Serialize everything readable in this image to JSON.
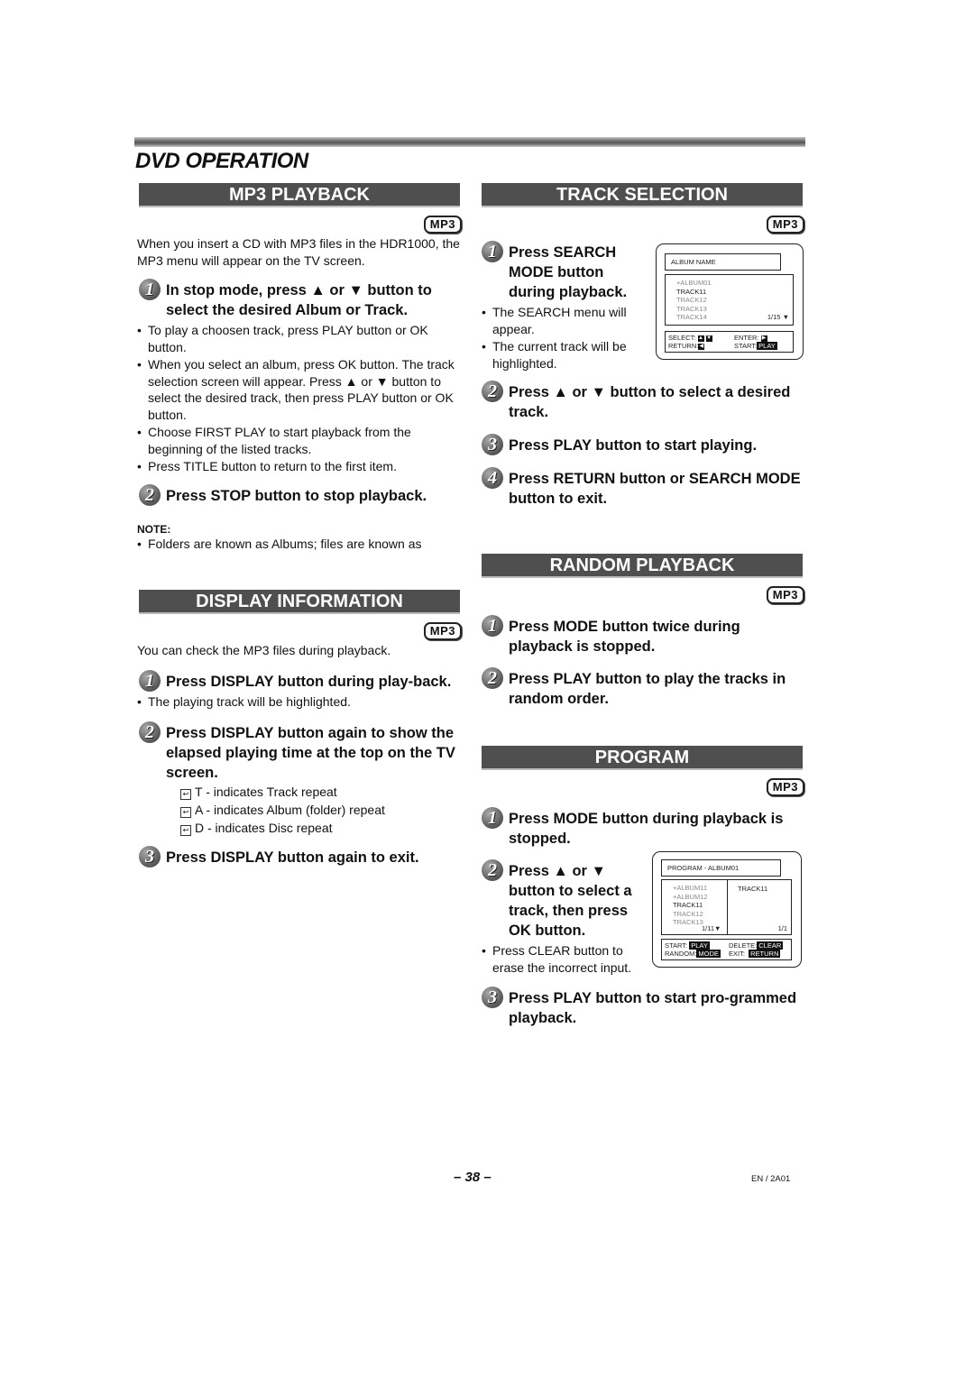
{
  "page": {
    "title": "DVD OPERATION",
    "page_number": "– 38 –",
    "doc_code": "EN / 2A01"
  },
  "badge": "MP3",
  "arrows": {
    "up": "▲",
    "down": "▼"
  },
  "mp3_playback": {
    "heading": "MP3 PLAYBACK",
    "intro": "When you insert a CD with MP3 files in the HDR1000, the MP3 menu will appear on the TV screen.",
    "step1": {
      "num": "1",
      "pre": "In stop mode, press ",
      "mid": " or ",
      "post": " button to select the desired Album or Track."
    },
    "bullets": [
      "To play a choosen track, press PLAY button or OK button.",
      "When you select an album, press OK button. The track selection screen will appear. Press ▲ or ▼ button to select the desired track, then press PLAY button or OK button.",
      "Choose FIRST PLAY to start playback from the beginning of the listed tracks.",
      "Press TITLE button to return to the first item."
    ],
    "step2": {
      "num": "2",
      "text": "Press STOP button to stop playback."
    },
    "note_label": "NOTE:",
    "note": "Folders are known as Albums; files are known as"
  },
  "display_information": {
    "heading": "DISPLAY INFORMATION",
    "intro": "You can check the MP3 files during playback.",
    "step1": {
      "num": "1",
      "text": "Press DISPLAY button during play-back."
    },
    "step1_bullet": "The playing track will be highlighted.",
    "step2": {
      "num": "2",
      "text": "Press DISPLAY button again to show the elapsed playing time at the top on the TV screen."
    },
    "repeat_items": [
      "T - indicates Track repeat",
      "A - indicates Album (folder) repeat",
      "D - indicates Disc repeat"
    ],
    "step3": {
      "num": "3",
      "text": "Press DISPLAY button again to exit."
    }
  },
  "track_selection": {
    "heading": "TRACK SELECTION",
    "step1": {
      "num": "1",
      "text": "Press SEARCH MODE button during playback."
    },
    "bullets": [
      "The SEARCH menu will appear.",
      "The current track will be highlighted."
    ],
    "osd": {
      "title": "ALBUM NAME",
      "list": [
        {
          "label": "+ALBUM01",
          "highlight": false
        },
        {
          "label": "TRACK11",
          "highlight": true
        },
        {
          "label": "TRACK12",
          "highlight": false
        },
        {
          "label": "TRACK13",
          "highlight": false
        },
        {
          "label": "TRACK14",
          "highlight": false
        }
      ],
      "page": "1/15",
      "select_label": "SELECT:",
      "enter_label": "ENTER:",
      "return_label": "RETURN:",
      "start_label": "START:",
      "start_key": "PLAY"
    },
    "step2": {
      "num": "2",
      "pre": "Press ",
      "mid": " or ",
      "post": " button to select a desired track."
    },
    "step3": {
      "num": "3",
      "text": "Press PLAY button to start playing."
    },
    "step4": {
      "num": "4",
      "text": "Press RETURN button or SEARCH MODE button to exit."
    }
  },
  "random_playback": {
    "heading": "RANDOM PLAYBACK",
    "step1": {
      "num": "1",
      "text": "Press MODE button twice during playback is stopped."
    },
    "step2": {
      "num": "2",
      "text": "Press PLAY button to play the tracks in random order."
    }
  },
  "program": {
    "heading": "PROGRAM",
    "step1": {
      "num": "1",
      "text": "Press MODE button during playback is stopped."
    },
    "step2": {
      "num": "2",
      "pre": "Press ",
      "mid": " or ",
      "post": " button to select a track, then press OK button."
    },
    "step2_bullet": "Press CLEAR button to erase the incorrect input.",
    "osd": {
      "title": "PROGRAM - ALBUM01",
      "list": [
        {
          "label": "+ALBUM11",
          "highlight": false
        },
        {
          "label": "+ALBUM12",
          "highlight": false
        },
        {
          "label": "TRACK11",
          "highlight": true
        },
        {
          "label": "TRACK12",
          "highlight": false
        },
        {
          "label": "TRACK13",
          "highlight": false
        }
      ],
      "list_page": "1/11",
      "program_list": [
        "TRACK11"
      ],
      "program_page": "1/1",
      "start_label": "START:",
      "start_key": "PLAY",
      "delete_label": "DELETE:",
      "delete_key": "CLEAR",
      "random_label": "RANDOM:",
      "random_key": "MODE",
      "exit_label": "EXIT:",
      "exit_key": "RETURN"
    },
    "step3": {
      "num": "3",
      "text": "Press PLAY button to start pro-grammed playback."
    }
  }
}
